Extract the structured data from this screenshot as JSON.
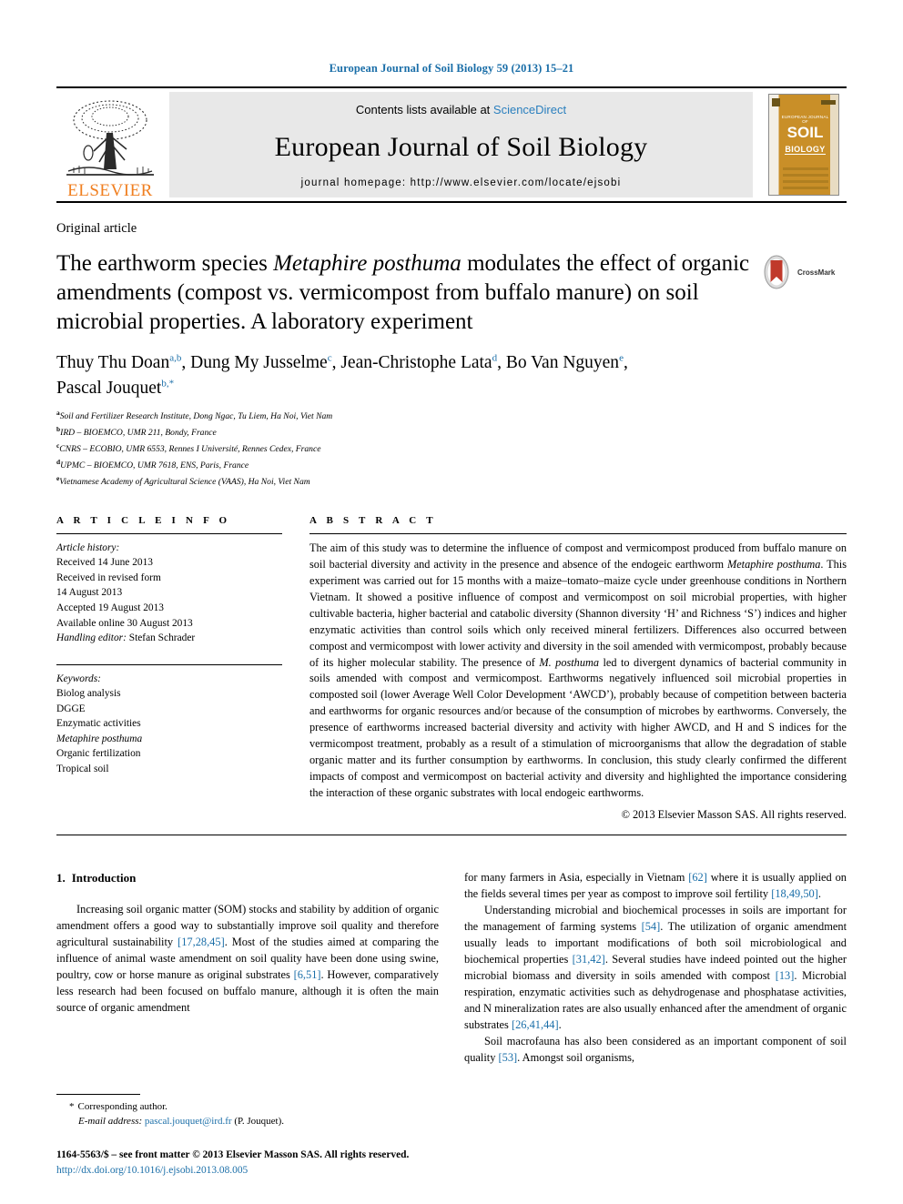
{
  "running_head": "European Journal of Soil Biology 59 (2013) 15–21",
  "masthead": {
    "contents_prefix": "Contents lists available at ",
    "sciencedirect": "ScienceDirect",
    "journal_title": "European Journal of Soil Biology",
    "homepage": "journal homepage: http://www.elsevier.com/locate/ejsobi",
    "publisher_wordmark": "ELSEVIER",
    "cover": {
      "top_line": "EUROPEAN JOURNAL OF",
      "title_1": "SOIL",
      "title_2": "BIOLOGY"
    },
    "link_color": "#2a7fbe",
    "elsevier_orange": "#F07F20"
  },
  "article_type": "Original article",
  "title": {
    "part1": "The earthworm species ",
    "species": "Metaphire posthuma",
    "part2": " modulates the effect of organic amendments (compost vs. vermicompost from buffalo manure) on soil microbial properties. A laboratory experiment"
  },
  "crossmark_label": "CrossMark",
  "authors": [
    {
      "name": "Thuy Thu Doan",
      "sup": "a,b",
      "sep": ", "
    },
    {
      "name": "Dung My Jusselme",
      "sup": "c",
      "sep": ", "
    },
    {
      "name": "Jean-Christophe Lata",
      "sup": "d",
      "sep": ", "
    },
    {
      "name": "Bo Van Nguyen",
      "sup": "e",
      "sep": ","
    },
    {
      "name": "Pascal Jouquet",
      "sup": "b,*",
      "sep": ""
    }
  ],
  "affiliations": [
    {
      "mark": "a",
      "text": "Soil and Fertilizer Research Institute, Dong Ngac, Tu Liem, Ha Noi, Viet Nam"
    },
    {
      "mark": "b",
      "text": "IRD – BIOEMCO, UMR 211, Bondy, France"
    },
    {
      "mark": "c",
      "text": "CNRS – ECOBIO, UMR 6553, Rennes I Université, Rennes Cedex, France"
    },
    {
      "mark": "d",
      "text": "UPMC – BIOEMCO, UMR 7618, ENS, Paris, France"
    },
    {
      "mark": "e",
      "text": "Vietnamese Academy of Agricultural Science (VAAS), Ha Noi, Viet Nam"
    }
  ],
  "article_info": {
    "heading": "A R T I C L E  I N F O",
    "history_label": "Article history:",
    "history": [
      "Received 14 June 2013",
      "Received in revised form",
      "14 August 2013",
      "Accepted 19 August 2013",
      "Available online 30 August 2013"
    ],
    "handling_editor_label": "Handling editor:",
    "handling_editor": " Stefan Schrader",
    "keywords_label": "Keywords:",
    "keywords": [
      "Biolog analysis",
      "DGGE",
      "Enzymatic activities",
      "Metaphire posthuma",
      "Organic fertilization",
      "Tropical soil"
    ],
    "keywords_italic_index": 3
  },
  "abstract": {
    "heading": "A B S T R A C T",
    "p1": "The aim of this study was to determine the influence of compost and vermicompost produced from buffalo manure on soil bacterial diversity and activity in the presence and absence of the endogeic earthworm ",
    "species1": "Metaphire posthuma",
    "p2": ". This experiment was carried out for 15 months with a maize–tomato–maize cycle under greenhouse conditions in Northern Vietnam. It showed a positive influence of compost and vermicompost on soil microbial properties, with higher cultivable bacteria, higher bacterial and catabolic diversity (Shannon diversity ‘H’ and Richness ‘S’) indices and higher enzymatic activities than control soils which only received mineral fertilizers. Differences also occurred between compost and vermicompost with lower activity and diversity in the soil amended with vermicompost, probably because of its higher molecular stability. The presence of ",
    "species2": "M. posthuma",
    "p3": " led to divergent dynamics of bacterial community in soils amended with compost and vermicompost. Earthworms negatively influenced soil microbial properties in composted soil (lower Average Well Color Development ‘AWCD’), probably because of competition between bacteria and earthworms for organic resources and/or because of the consumption of microbes by earthworms. Conversely, the presence of earthworms increased bacterial diversity and activity with higher AWCD, and H and S indices for the vermicompost treatment, probably as a result of a stimulation of microorganisms that allow the degradation of stable organic matter and its further consumption by earthworms. In conclusion, this study clearly confirmed the different impacts of compost and vermicompost on bacterial activity and diversity and highlighted the importance considering the interaction of these organic substrates with local endogeic earthworms.",
    "copyright": "© 2013 Elsevier Masson SAS. All rights reserved."
  },
  "introduction": {
    "number": "1.",
    "title": "Introduction",
    "left_p1_a": "Increasing soil organic matter (SOM) stocks and stability by addition of organic amendment offers a good way to substantially improve soil quality and therefore agricultural sustainability ",
    "left_ref1": "[17,28,45]",
    "left_p1_b": ". Most of the studies aimed at comparing the influence of animal waste amendment on soil quality have been done using swine, poultry, cow or horse manure as original substrates ",
    "left_ref2": "[6,51]",
    "left_p1_c": ". However, comparatively less research had been focused on buffalo manure, although it is often the main source of organic amendment",
    "right_p1_a": "for many farmers in Asia, especially in Vietnam ",
    "right_ref1": "[62]",
    "right_p1_b": " where it is usually applied on the fields several times per year as compost to improve soil fertility ",
    "right_ref2": "[18,49,50]",
    "right_p1_c": ".",
    "right_p2_a": "Understanding microbial and biochemical processes in soils are important for the management of farming systems ",
    "right_ref3": "[54]",
    "right_p2_b": ". The utilization of organic amendment usually leads to important modifications of both soil microbiological and biochemical properties ",
    "right_ref4": "[31,42]",
    "right_p2_c": ". Several studies have indeed pointed out the higher microbial biomass and diversity in soils amended with compost ",
    "right_ref5": "[13]",
    "right_p2_d": ". Microbial respiration, enzymatic activities such as dehydrogenase and phosphatase activities, and N mineralization rates are also usually enhanced after the amendment of organic substrates ",
    "right_ref6": "[26,41,44]",
    "right_p2_e": ".",
    "right_p3_a": "Soil macrofauna has also been considered as an important component of soil quality ",
    "right_ref7": "[53]",
    "right_p3_b": ". Amongst soil organisms,"
  },
  "footer": {
    "corresponding_star": "*",
    "corresponding_label": "Corresponding author.",
    "email_label": "E-mail address:",
    "email": "pascal.jouquet@ird.fr",
    "email_suffix": " (P. Jouquet).",
    "issn_line": "1164-5563/$ – see front matter © 2013 Elsevier Masson SAS. All rights reserved.",
    "doi": "http://dx.doi.org/10.1016/j.ejsobi.2013.08.005"
  }
}
